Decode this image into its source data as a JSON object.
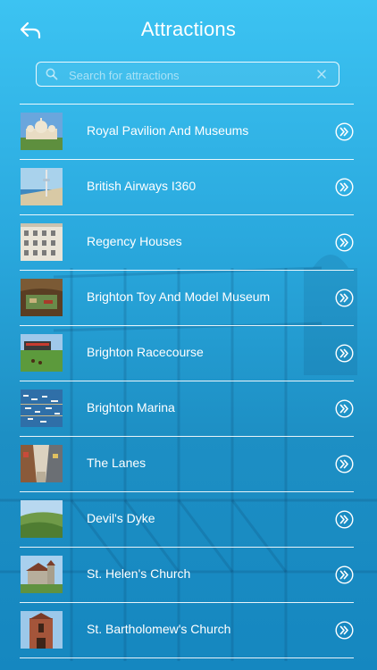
{
  "header": {
    "title": "Attractions",
    "back_icon": "back-arrow-icon"
  },
  "search": {
    "placeholder": "Search for attractions",
    "value": "",
    "search_icon": "search-icon",
    "clear_icon": "clear-icon"
  },
  "attractions": [
    {
      "name": "Royal Pavilion And Museums",
      "thumb": "pavilion"
    },
    {
      "name": "British Airways I360",
      "thumb": "tower"
    },
    {
      "name": "Regency Houses",
      "thumb": "houses"
    },
    {
      "name": "Brighton Toy And Model Museum",
      "thumb": "museum"
    },
    {
      "name": "Brighton Racecourse",
      "thumb": "racecourse"
    },
    {
      "name": "Brighton Marina",
      "thumb": "marina"
    },
    {
      "name": "The Lanes",
      "thumb": "lanes"
    },
    {
      "name": "Devil's Dyke",
      "thumb": "dyke"
    },
    {
      "name": "St. Helen's Church",
      "thumb": "church-flint"
    },
    {
      "name": "St. Bartholomew's Church",
      "thumb": "church-brick"
    }
  ],
  "colors": {
    "background_top": "#3cc3f2",
    "background_bottom": "#1587c0",
    "text": "#ffffff"
  }
}
